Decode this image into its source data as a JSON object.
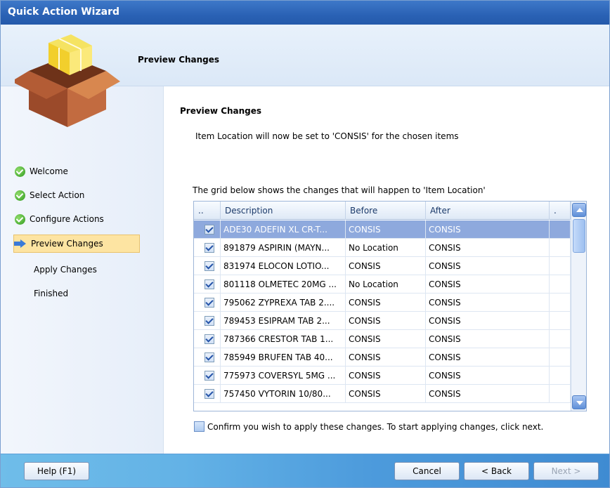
{
  "window": {
    "title": "Quick Action Wizard"
  },
  "header": {
    "title": "Preview Changes"
  },
  "sidebar": {
    "items": [
      {
        "label": "Welcome",
        "state": "done"
      },
      {
        "label": "Select Action",
        "state": "done"
      },
      {
        "label": "Configure Actions",
        "state": "done"
      },
      {
        "label": "Preview Changes",
        "state": "current"
      },
      {
        "label": "Apply Changes",
        "state": "pending"
      },
      {
        "label": "Finished",
        "state": "pending"
      }
    ]
  },
  "main": {
    "title": "Preview Changes",
    "description": "Item Location will now be set to 'CONSIS' for the chosen items",
    "grid_caption": "The grid below shows the changes that will happen to 'Item Location'"
  },
  "grid": {
    "columns": [
      "..",
      "Description",
      "Before",
      "After",
      "."
    ],
    "rows": [
      {
        "checked": true,
        "description": "ADE30 ADEFIN XL CR-T...",
        "before": "CONSIS",
        "after": "CONSIS",
        "selected": true
      },
      {
        "checked": true,
        "description": "891879 ASPIRIN (MAYN...",
        "before": "No Location",
        "after": "CONSIS"
      },
      {
        "checked": true,
        "description": "831974 ELOCON LOTIO...",
        "before": "CONSIS",
        "after": "CONSIS"
      },
      {
        "checked": true,
        "description": "801118 OLMETEC 20MG ...",
        "before": "No Location",
        "after": "CONSIS"
      },
      {
        "checked": true,
        "description": "795062 ZYPREXA TAB 2....",
        "before": "CONSIS",
        "after": "CONSIS"
      },
      {
        "checked": true,
        "description": "789453 ESIPRAM TAB 2...",
        "before": "CONSIS",
        "after": "CONSIS"
      },
      {
        "checked": true,
        "description": "787366 CRESTOR TAB 1...",
        "before": "CONSIS",
        "after": "CONSIS"
      },
      {
        "checked": true,
        "description": "785949 BRUFEN TAB 40...",
        "before": "CONSIS",
        "after": "CONSIS"
      },
      {
        "checked": true,
        "description": "775973 COVERSYL 5MG ...",
        "before": "CONSIS",
        "after": "CONSIS"
      },
      {
        "checked": true,
        "description": "757450 VYTORIN 10/80...",
        "before": "CONSIS",
        "after": "CONSIS"
      }
    ]
  },
  "confirm": {
    "label": "Confirm you wish to apply these changes. To start applying changes, click next.",
    "checked": false
  },
  "footer": {
    "help_label": "Help (F1)",
    "cancel_label": "Cancel",
    "back_label": "< Back",
    "next_label": "Next >"
  },
  "colors": {
    "title_bar": "#2a62b5",
    "selected_row": "#8ea9dd",
    "active_step": "#fde4a2"
  },
  "icons": {
    "step_done": "check-icon",
    "step_current": "arrow-icon",
    "wizard": "box-icon"
  }
}
